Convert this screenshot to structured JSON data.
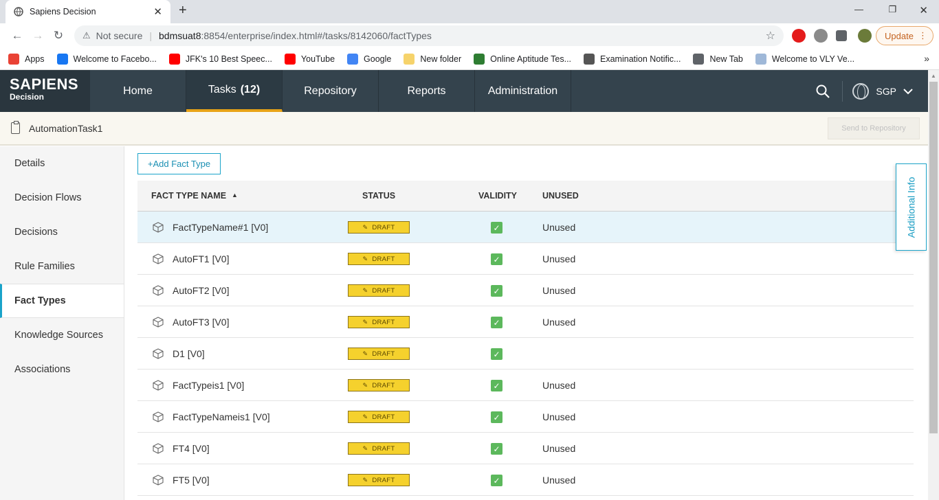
{
  "browser": {
    "tab_title": "Sapiens Decision",
    "not_secure": "Not secure",
    "url_host": "bdmsuat8",
    "url_path": ":8854/enterprise/index.html#/tasks/8142060/factTypes",
    "update_label": "Update",
    "bookmarks": [
      {
        "label": "Apps",
        "icon": "apps-grid-icon",
        "color": "#e94235"
      },
      {
        "label": "Welcome to Facebo...",
        "icon": "facebook-icon",
        "color": "#1877f2"
      },
      {
        "label": "JFK's 10 Best Speec...",
        "icon": "youtube-icon",
        "color": "#ff0000"
      },
      {
        "label": "YouTube",
        "icon": "youtube-icon",
        "color": "#ff0000"
      },
      {
        "label": "Google",
        "icon": "google-icon",
        "color": "#4285f4"
      },
      {
        "label": "New folder",
        "icon": "folder-icon",
        "color": "#f6d36b"
      },
      {
        "label": "Online Aptitude Tes...",
        "icon": "palm-tree-icon",
        "color": "#2e7d32"
      },
      {
        "label": "Examination Notific...",
        "icon": "emblem-icon",
        "color": "#555555"
      },
      {
        "label": "New Tab",
        "icon": "globe-icon",
        "color": "#5f6368"
      },
      {
        "label": "Welcome to VLY Ve...",
        "icon": "document-icon",
        "color": "#9fb8d8"
      }
    ]
  },
  "app": {
    "logo_line1": "SAPIENS",
    "logo_line2": "Decision",
    "nav": [
      {
        "label": "Home",
        "active": false
      },
      {
        "label": "Tasks",
        "count": "(12)",
        "active": true
      },
      {
        "label": "Repository",
        "active": false
      },
      {
        "label": "Reports",
        "active": false
      },
      {
        "label": "Administration",
        "active": false
      }
    ],
    "region": "SGP",
    "accent_color": "#e8a317",
    "header_color": "#34434d"
  },
  "task": {
    "name": "AutomationTask1",
    "send_to_repository": "Send to Repository"
  },
  "sidebar": {
    "items": [
      {
        "label": "Details",
        "active": false
      },
      {
        "label": "Decision Flows",
        "active": false
      },
      {
        "label": "Decisions",
        "active": false
      },
      {
        "label": "Rule Families",
        "active": false
      },
      {
        "label": "Fact Types",
        "active": true
      },
      {
        "label": "Knowledge Sources",
        "active": false
      },
      {
        "label": "Associations",
        "active": false
      }
    ]
  },
  "main": {
    "add_button": "+Add Fact Type",
    "columns": {
      "name": "FACT TYPE NAME",
      "status": "STATUS",
      "validity": "VALIDITY",
      "unused": "UNUSED"
    },
    "rows": [
      {
        "name": "FactTypeName#1 [V0]",
        "status": "DRAFT",
        "valid": true,
        "unused": "Unused",
        "selected": true
      },
      {
        "name": "AutoFT1 [V0]",
        "status": "DRAFT",
        "valid": true,
        "unused": "Unused",
        "selected": false
      },
      {
        "name": "AutoFT2 [V0]",
        "status": "DRAFT",
        "valid": true,
        "unused": "Unused",
        "selected": false
      },
      {
        "name": "AutoFT3 [V0]",
        "status": "DRAFT",
        "valid": true,
        "unused": "Unused",
        "selected": false
      },
      {
        "name": "D1 [V0]",
        "status": "DRAFT",
        "valid": true,
        "unused": "",
        "selected": false
      },
      {
        "name": "FactTypeis1 [V0]",
        "status": "DRAFT",
        "valid": true,
        "unused": "Unused",
        "selected": false
      },
      {
        "name": "FactTypeNameis1 [V0]",
        "status": "DRAFT",
        "valid": true,
        "unused": "Unused",
        "selected": false
      },
      {
        "name": "FT4 [V0]",
        "status": "DRAFT",
        "valid": true,
        "unused": "Unused",
        "selected": false
      },
      {
        "name": "FT5 [V0]",
        "status": "DRAFT",
        "valid": true,
        "unused": "Unused",
        "selected": false
      }
    ],
    "additional_info": "Additional Info"
  }
}
